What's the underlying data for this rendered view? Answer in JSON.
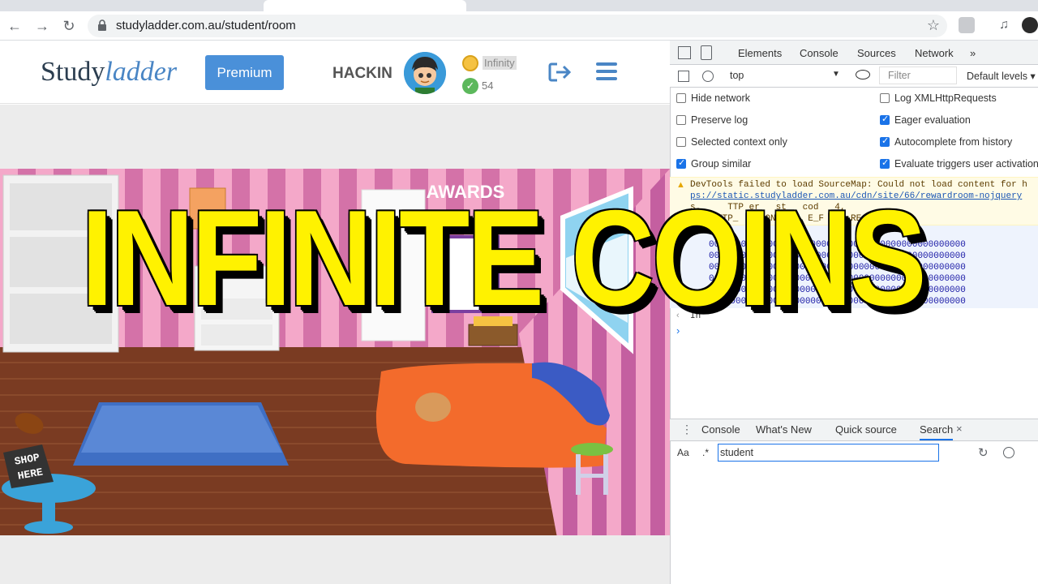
{
  "browser": {
    "url": "studyladder.com.au/student/room"
  },
  "header": {
    "logo_study": "Study",
    "logo_ladder": "ladder",
    "premium_label": "Premium",
    "username": "HACKIN",
    "coins": "Infinity",
    "points": "54"
  },
  "room": {
    "awards_label": "AWARDS",
    "shop_line1": "SHOP",
    "shop_line2": "HERE"
  },
  "overlay": {
    "title": "INFINITE COINS"
  },
  "devtools": {
    "tabs": [
      "Elements",
      "Console",
      "Sources",
      "Network",
      "»"
    ],
    "context": "top",
    "filter_placeholder": "Filter",
    "levels": "Default levels ▾",
    "options_left": [
      "Hide network",
      "Preserve log",
      "Selected context only",
      "Group similar"
    ],
    "options_left_checked": [
      false,
      false,
      false,
      true
    ],
    "options_right": [
      "Log XMLHttpRequests",
      "Eager evaluation",
      "Autocomplete from history",
      "Evaluate triggers user activation"
    ],
    "options_right_checked": [
      false,
      true,
      true,
      true
    ],
    "warning_line1": "DevTools failed to load SourceMap: Could not load content for h",
    "warning_line2": "ps://static.studyladder.com.au/cdn/site/66/rewardroom-nojquery",
    "warning_line3": "s.     TTP er   st   cod   4,",
    "warning_line4": "     TTP_     ONS     E_F     RE",
    "binary_row": "000000000000000000000000000000000000000000000000",
    "result_prefix": "In",
    "drawer_tabs": [
      "Console",
      "What's New",
      "Quick source",
      "Search"
    ],
    "search_case": "Aa",
    "search_regex": ".*",
    "search_value": "student"
  }
}
